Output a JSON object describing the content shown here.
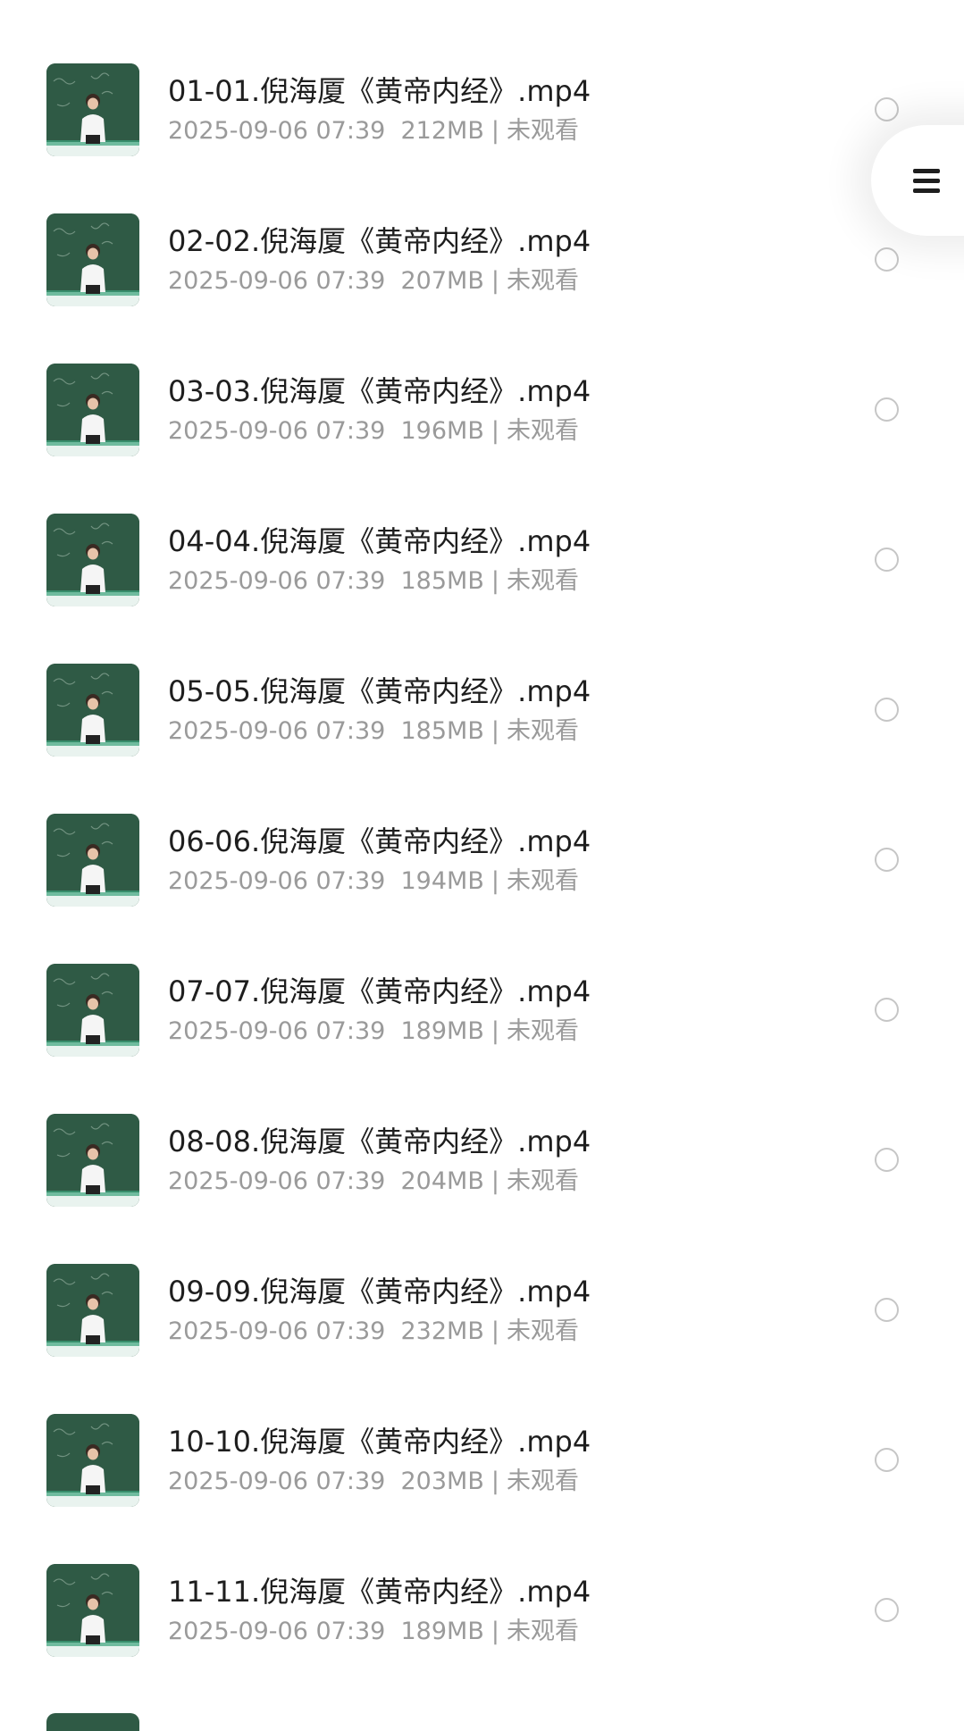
{
  "files": [
    {
      "name": "01-01.倪海厦《黄帝内经》.mp4",
      "date": "2025-09-06 07:39",
      "size": "212MB",
      "status": "未观看"
    },
    {
      "name": "02-02.倪海厦《黄帝内经》.mp4",
      "date": "2025-09-06 07:39",
      "size": "207MB",
      "status": "未观看"
    },
    {
      "name": "03-03.倪海厦《黄帝内经》.mp4",
      "date": "2025-09-06 07:39",
      "size": "196MB",
      "status": "未观看"
    },
    {
      "name": "04-04.倪海厦《黄帝内经》.mp4",
      "date": "2025-09-06 07:39",
      "size": "185MB",
      "status": "未观看"
    },
    {
      "name": "05-05.倪海厦《黄帝内经》.mp4",
      "date": "2025-09-06 07:39",
      "size": "185MB",
      "status": "未观看"
    },
    {
      "name": "06-06.倪海厦《黄帝内经》.mp4",
      "date": "2025-09-06 07:39",
      "size": "194MB",
      "status": "未观看"
    },
    {
      "name": "07-07.倪海厦《黄帝内经》.mp4",
      "date": "2025-09-06 07:39",
      "size": "189MB",
      "status": "未观看"
    },
    {
      "name": "08-08.倪海厦《黄帝内经》.mp4",
      "date": "2025-09-06 07:39",
      "size": "204MB",
      "status": "未观看"
    },
    {
      "name": "09-09.倪海厦《黄帝内经》.mp4",
      "date": "2025-09-06 07:39",
      "size": "232MB",
      "status": "未观看"
    },
    {
      "name": "10-10.倪海厦《黄帝内经》.mp4",
      "date": "2025-09-06 07:39",
      "size": "203MB",
      "status": "未观看"
    },
    {
      "name": "11-11.倪海厦《黄帝内经》.mp4",
      "date": "2025-09-06 07:39",
      "size": "189MB",
      "status": "未观看"
    }
  ],
  "meta_separator": "|",
  "icons": {
    "thumbnail": "video-thumbnail-icon",
    "select": "radio-circle-icon",
    "menu": "hamburger-menu-icon"
  },
  "colors": {
    "title": "#1e1e1e",
    "meta": "#9a9a9a",
    "thumbnail_board": "#2f5a45",
    "radio_border": "#c6c6c6"
  }
}
